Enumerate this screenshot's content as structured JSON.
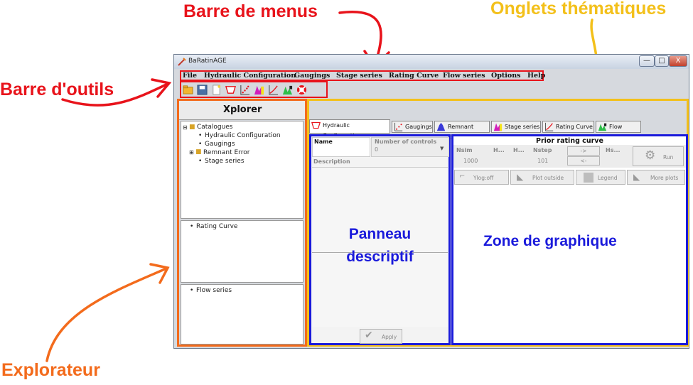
{
  "annotations": {
    "menubar": "Barre de menus",
    "tabs": "Onglets thématiques",
    "toolbar": "Barre d'outils",
    "explorer": "Explorateur",
    "descriptive": "Panneau descriptif",
    "chart_zone": "Zone de graphique",
    "colors": {
      "red": "#e8131b",
      "yellow": "#f3c01a",
      "orange": "#f36b1c",
      "blue": "#1a1adb"
    }
  },
  "window": {
    "title": "BaRatinAGE",
    "min_glyph": "—",
    "max_glyph": "□",
    "close_glyph": "X"
  },
  "menu": [
    "File",
    "Hydraulic Configuration",
    "Gaugings",
    "Stage series",
    "Rating Curve",
    "Flow series",
    "Options",
    "Help"
  ],
  "toolbar_icons": [
    "open-folder-icon",
    "save-icon",
    "new-file-icon",
    "hydraulic-config-icon",
    "gaugings-icon",
    "stage-series-icon",
    "rating-curve-icon",
    "flow-series-icon",
    "help-lifebuoy-icon"
  ],
  "explorer": {
    "title": "Xplorer",
    "tree": {
      "root": "Catalogues",
      "children": [
        "Hydraulic Configuration",
        "Gaugings",
        "Remnant Error",
        "Stage series"
      ]
    },
    "rating_item": "Rating Curve",
    "flow_item": "Flow series"
  },
  "tabs": [
    "Hydraulic Configuration",
    "Gaugings",
    "Remnant Error",
    "Stage series",
    "Rating Curve",
    "Flow series"
  ],
  "form": {
    "name_label": "Name",
    "controls_label": "Number of controls",
    "controls_value": "0",
    "description_label": "Description",
    "apply": "Apply"
  },
  "prior": {
    "title": "Prior rating curve",
    "headers": [
      "Nsim",
      "H...",
      "H...",
      "Nstep",
      "Hs..."
    ],
    "nsim": "1000",
    "nstep": "101",
    "arrow_right": "->",
    "arrow_left": "<-",
    "run": "Run",
    "buttons": [
      "Ylog:off",
      "Plot outside",
      "Legend",
      "More plots"
    ]
  }
}
